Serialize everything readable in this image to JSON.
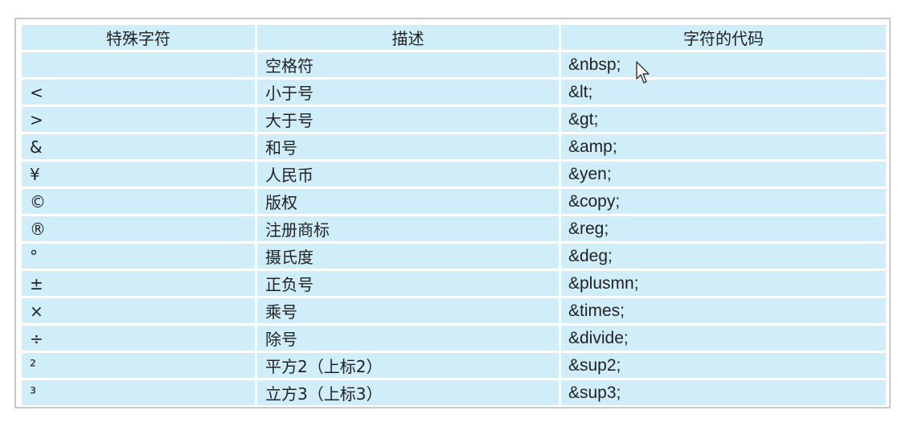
{
  "table": {
    "headers": [
      "特殊字符",
      "描述",
      "字符的代码"
    ],
    "rows": [
      {
        "symbol": "",
        "description": "空格符",
        "code": "&nbsp;"
      },
      {
        "symbol": "<",
        "description": "小于号",
        "code": "&lt;"
      },
      {
        "symbol": ">",
        "description": "大于号",
        "code": "&gt;"
      },
      {
        "symbol": "&",
        "description": "和号",
        "code": "&amp;"
      },
      {
        "symbol": "¥",
        "description": "人民币",
        "code": "&yen;"
      },
      {
        "symbol": "©",
        "description": "版权",
        "code": "&copy;"
      },
      {
        "symbol": "®",
        "description": "注册商标",
        "code": "&reg;"
      },
      {
        "symbol": "°",
        "description": "摄氏度",
        "code": "&deg;"
      },
      {
        "symbol": "±",
        "description": "正负号",
        "code": "&plusmn;"
      },
      {
        "symbol": "×",
        "description": "乘号",
        "code": "&times;"
      },
      {
        "symbol": "÷",
        "description": "除号",
        "code": "&divide;"
      },
      {
        "symbol": "²",
        "description": "平方2（上标2）",
        "code": "&sup2;"
      },
      {
        "symbol": "³",
        "description": "立方3（上标3）",
        "code": "&sup3;"
      }
    ]
  },
  "colors": {
    "cell_background": "#cfeefa",
    "frame_border": "#c9c9c9",
    "text": "#222222"
  },
  "icons": [
    "mouse-cursor-icon"
  ]
}
